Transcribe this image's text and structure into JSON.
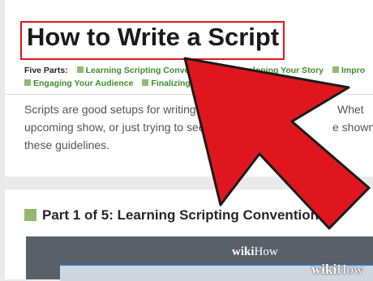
{
  "article": {
    "title": "How to Write a Script",
    "parts_label": "Five Parts:",
    "parts": [
      "Learning Scripting Conventions",
      "Developing Your Story",
      "Impro",
      "Engaging Your Audience",
      "Finalizing"
    ],
    "intro_lines": [
      "Scripts are good setups for writing",
      "upcoming show, or just trying to see",
      "these guidelines."
    ],
    "intro_tail_1": "Whet",
    "intro_tail_2": "e shown"
  },
  "section": {
    "heading": "Part 1 of 5: Learning Scripting Conventions"
  },
  "media": {
    "logo_bold": "wiki",
    "logo_light": "How"
  },
  "watermark": {
    "bold": "wiki",
    "light": "How"
  },
  "colors": {
    "highlight_border": "#e0161e",
    "arrow_fill": "#e0161e",
    "link_green": "#3e8a2e",
    "square_green": "#93b874"
  },
  "icons": {
    "pointer": "red-arrow-icon",
    "part_marker": "green-square-icon"
  }
}
